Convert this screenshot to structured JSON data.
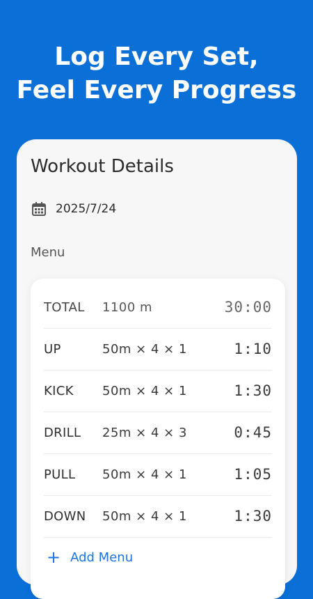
{
  "headline": {
    "line1": "Log Every Set,",
    "line2": "Feel Every Progress"
  },
  "card": {
    "title": "Workout Details",
    "date": "2025/7/24",
    "menu_label": "Menu"
  },
  "menu": {
    "rows": [
      {
        "name": "TOTAL",
        "spec": "1100 m",
        "time": "30:00"
      },
      {
        "name": "UP",
        "spec": "50m × 4 × 1",
        "time": "1:10"
      },
      {
        "name": "KICK",
        "spec": "50m × 4 × 1",
        "time": "1:30"
      },
      {
        "name": "DRILL",
        "spec": "25m × 4 × 3",
        "time": "0:45"
      },
      {
        "name": "PULL",
        "spec": "50m × 4 × 1",
        "time": "1:05"
      },
      {
        "name": "DOWN",
        "spec": "50m × 4 × 1",
        "time": "1:30"
      }
    ],
    "add_label": "Add Menu"
  },
  "icons": {
    "date": "calendar-icon",
    "add": "plus-icon"
  },
  "colors": {
    "background": "#0b6fd8",
    "card": "#f7f7f7",
    "accent": "#1a73e8"
  }
}
